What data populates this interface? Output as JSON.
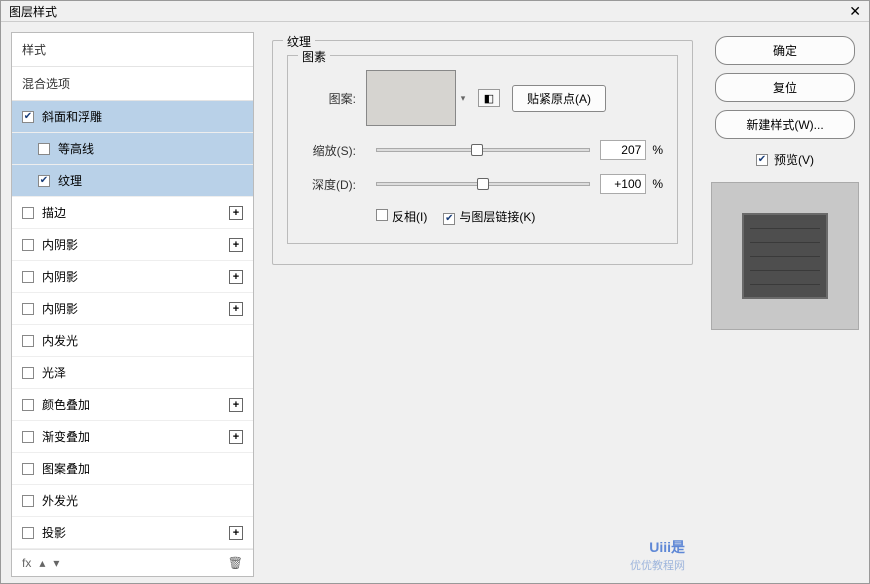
{
  "title": "图层样式",
  "sidebar": {
    "styles_header": "样式",
    "blend_header": "混合选项",
    "items": [
      {
        "label": "斜面和浮雕",
        "checked": true,
        "selected": true,
        "sub": false,
        "add": false
      },
      {
        "label": "等高线",
        "checked": false,
        "selected": true,
        "sub": true,
        "add": false
      },
      {
        "label": "纹理",
        "checked": true,
        "selected": true,
        "sub": true,
        "add": false
      },
      {
        "label": "描边",
        "checked": false,
        "selected": false,
        "sub": false,
        "add": true
      },
      {
        "label": "内阴影",
        "checked": false,
        "selected": false,
        "sub": false,
        "add": true
      },
      {
        "label": "内阴影",
        "checked": false,
        "selected": false,
        "sub": false,
        "add": true
      },
      {
        "label": "内阴影",
        "checked": false,
        "selected": false,
        "sub": false,
        "add": true
      },
      {
        "label": "内发光",
        "checked": false,
        "selected": false,
        "sub": false,
        "add": false
      },
      {
        "label": "光泽",
        "checked": false,
        "selected": false,
        "sub": false,
        "add": false
      },
      {
        "label": "颜色叠加",
        "checked": false,
        "selected": false,
        "sub": false,
        "add": true
      },
      {
        "label": "渐变叠加",
        "checked": false,
        "selected": false,
        "sub": false,
        "add": true
      },
      {
        "label": "图案叠加",
        "checked": false,
        "selected": false,
        "sub": false,
        "add": false
      },
      {
        "label": "外发光",
        "checked": false,
        "selected": false,
        "sub": false,
        "add": false
      },
      {
        "label": "投影",
        "checked": false,
        "selected": false,
        "sub": false,
        "add": true
      }
    ],
    "fx_label": "fx"
  },
  "center": {
    "section_title": "纹理",
    "pattern_group": "图素",
    "pattern_label": "图案:",
    "snap_btn": "贴紧原点(A)",
    "scale_label": "缩放(S):",
    "scale_value": "207",
    "depth_label": "深度(D):",
    "depth_value": "+100",
    "pct": "%",
    "invert_label": "反相(I)",
    "link_label": "与图层链接(K)",
    "link_checked": true,
    "invert_checked": false,
    "scale_thumb_pos": "47%",
    "depth_thumb_pos": "50%"
  },
  "right": {
    "ok": "确定",
    "reset": "复位",
    "new_style": "新建样式(W)...",
    "preview": "预览(V)",
    "preview_checked": true
  },
  "watermark": {
    "brand": "Uiii是",
    "sub": "优优教程网"
  }
}
